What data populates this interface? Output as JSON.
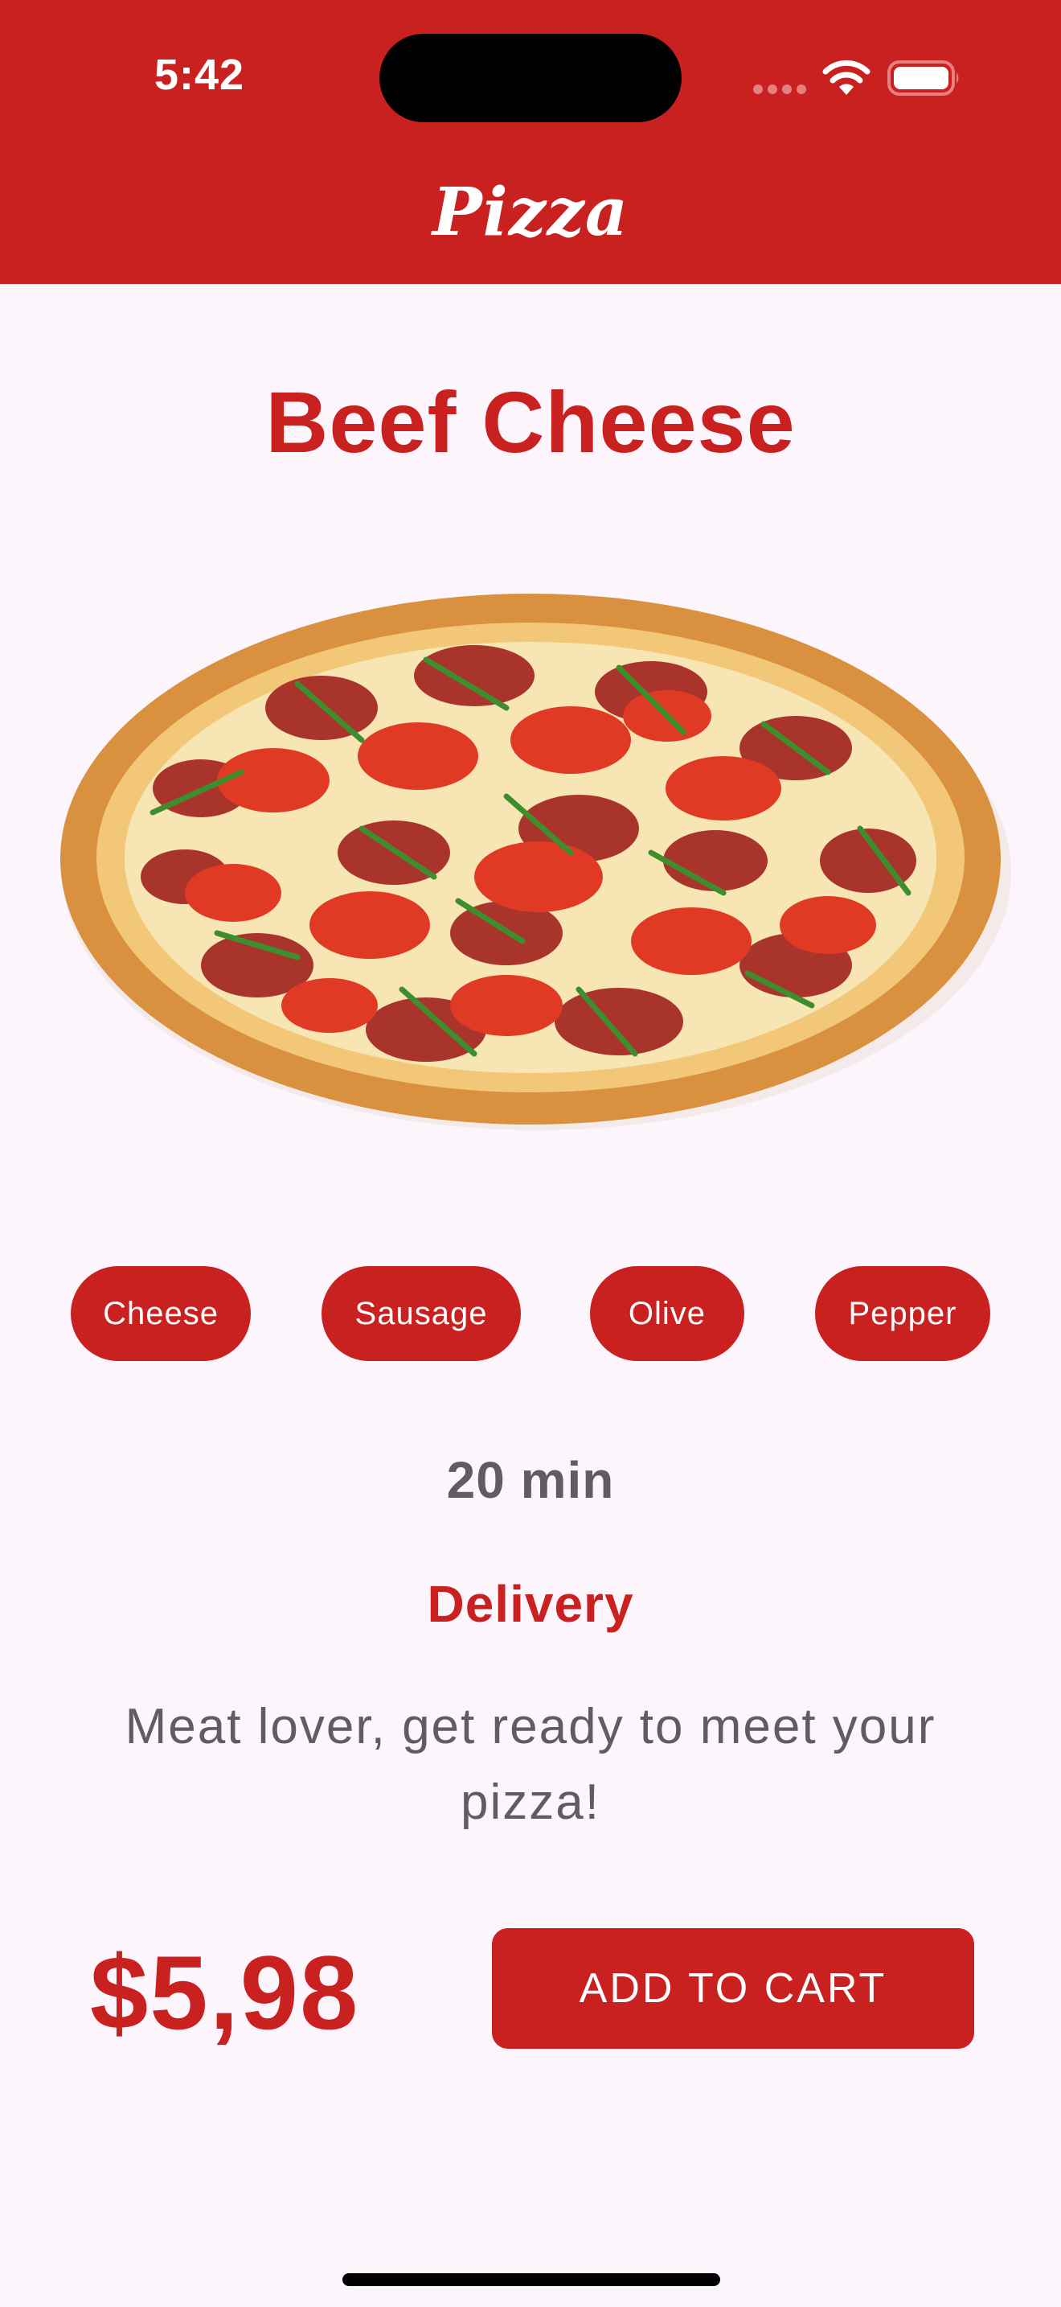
{
  "status_bar": {
    "time": "5:42",
    "icons": [
      "cellular-signal-icon",
      "wifi-icon",
      "battery-icon"
    ]
  },
  "header": {
    "title": "Pizza"
  },
  "product": {
    "name": "Beef Cheese",
    "image": "pizza-image",
    "ingredients": [
      "Cheese",
      "Sausage",
      "Olive",
      "Pepper"
    ],
    "time": "20 min",
    "delivery_label": "Delivery",
    "description": "Meat lover, get ready to meet your pizza!",
    "price": "$5,98",
    "add_to_cart_label": "ADD TO CART"
  },
  "colors": {
    "brand": "#C92020",
    "background": "#FDF5FC",
    "muted_text": "#5F5C63"
  }
}
